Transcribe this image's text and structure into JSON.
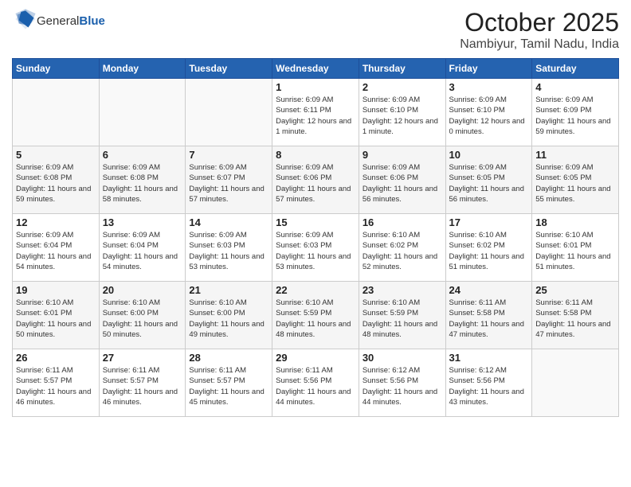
{
  "logo": {
    "general": "General",
    "blue": "Blue"
  },
  "header": {
    "month": "October 2025",
    "location": "Nambiyur, Tamil Nadu, India"
  },
  "weekdays": [
    "Sunday",
    "Monday",
    "Tuesday",
    "Wednesday",
    "Thursday",
    "Friday",
    "Saturday"
  ],
  "weeks": [
    [
      {
        "day": "",
        "info": ""
      },
      {
        "day": "",
        "info": ""
      },
      {
        "day": "",
        "info": ""
      },
      {
        "day": "1",
        "info": "Sunrise: 6:09 AM\nSunset: 6:11 PM\nDaylight: 12 hours\nand 1 minute."
      },
      {
        "day": "2",
        "info": "Sunrise: 6:09 AM\nSunset: 6:10 PM\nDaylight: 12 hours\nand 1 minute."
      },
      {
        "day": "3",
        "info": "Sunrise: 6:09 AM\nSunset: 6:10 PM\nDaylight: 12 hours\nand 0 minutes."
      },
      {
        "day": "4",
        "info": "Sunrise: 6:09 AM\nSunset: 6:09 PM\nDaylight: 11 hours\nand 59 minutes."
      }
    ],
    [
      {
        "day": "5",
        "info": "Sunrise: 6:09 AM\nSunset: 6:08 PM\nDaylight: 11 hours\nand 59 minutes."
      },
      {
        "day": "6",
        "info": "Sunrise: 6:09 AM\nSunset: 6:08 PM\nDaylight: 11 hours\nand 58 minutes."
      },
      {
        "day": "7",
        "info": "Sunrise: 6:09 AM\nSunset: 6:07 PM\nDaylight: 11 hours\nand 57 minutes."
      },
      {
        "day": "8",
        "info": "Sunrise: 6:09 AM\nSunset: 6:06 PM\nDaylight: 11 hours\nand 57 minutes."
      },
      {
        "day": "9",
        "info": "Sunrise: 6:09 AM\nSunset: 6:06 PM\nDaylight: 11 hours\nand 56 minutes."
      },
      {
        "day": "10",
        "info": "Sunrise: 6:09 AM\nSunset: 6:05 PM\nDaylight: 11 hours\nand 56 minutes."
      },
      {
        "day": "11",
        "info": "Sunrise: 6:09 AM\nSunset: 6:05 PM\nDaylight: 11 hours\nand 55 minutes."
      }
    ],
    [
      {
        "day": "12",
        "info": "Sunrise: 6:09 AM\nSunset: 6:04 PM\nDaylight: 11 hours\nand 54 minutes."
      },
      {
        "day": "13",
        "info": "Sunrise: 6:09 AM\nSunset: 6:04 PM\nDaylight: 11 hours\nand 54 minutes."
      },
      {
        "day": "14",
        "info": "Sunrise: 6:09 AM\nSunset: 6:03 PM\nDaylight: 11 hours\nand 53 minutes."
      },
      {
        "day": "15",
        "info": "Sunrise: 6:09 AM\nSunset: 6:03 PM\nDaylight: 11 hours\nand 53 minutes."
      },
      {
        "day": "16",
        "info": "Sunrise: 6:10 AM\nSunset: 6:02 PM\nDaylight: 11 hours\nand 52 minutes."
      },
      {
        "day": "17",
        "info": "Sunrise: 6:10 AM\nSunset: 6:02 PM\nDaylight: 11 hours\nand 51 minutes."
      },
      {
        "day": "18",
        "info": "Sunrise: 6:10 AM\nSunset: 6:01 PM\nDaylight: 11 hours\nand 51 minutes."
      }
    ],
    [
      {
        "day": "19",
        "info": "Sunrise: 6:10 AM\nSunset: 6:01 PM\nDaylight: 11 hours\nand 50 minutes."
      },
      {
        "day": "20",
        "info": "Sunrise: 6:10 AM\nSunset: 6:00 PM\nDaylight: 11 hours\nand 50 minutes."
      },
      {
        "day": "21",
        "info": "Sunrise: 6:10 AM\nSunset: 6:00 PM\nDaylight: 11 hours\nand 49 minutes."
      },
      {
        "day": "22",
        "info": "Sunrise: 6:10 AM\nSunset: 5:59 PM\nDaylight: 11 hours\nand 48 minutes."
      },
      {
        "day": "23",
        "info": "Sunrise: 6:10 AM\nSunset: 5:59 PM\nDaylight: 11 hours\nand 48 minutes."
      },
      {
        "day": "24",
        "info": "Sunrise: 6:11 AM\nSunset: 5:58 PM\nDaylight: 11 hours\nand 47 minutes."
      },
      {
        "day": "25",
        "info": "Sunrise: 6:11 AM\nSunset: 5:58 PM\nDaylight: 11 hours\nand 47 minutes."
      }
    ],
    [
      {
        "day": "26",
        "info": "Sunrise: 6:11 AM\nSunset: 5:57 PM\nDaylight: 11 hours\nand 46 minutes."
      },
      {
        "day": "27",
        "info": "Sunrise: 6:11 AM\nSunset: 5:57 PM\nDaylight: 11 hours\nand 46 minutes."
      },
      {
        "day": "28",
        "info": "Sunrise: 6:11 AM\nSunset: 5:57 PM\nDaylight: 11 hours\nand 45 minutes."
      },
      {
        "day": "29",
        "info": "Sunrise: 6:11 AM\nSunset: 5:56 PM\nDaylight: 11 hours\nand 44 minutes."
      },
      {
        "day": "30",
        "info": "Sunrise: 6:12 AM\nSunset: 5:56 PM\nDaylight: 11 hours\nand 44 minutes."
      },
      {
        "day": "31",
        "info": "Sunrise: 6:12 AM\nSunset: 5:56 PM\nDaylight: 11 hours\nand 43 minutes."
      },
      {
        "day": "",
        "info": ""
      }
    ]
  ]
}
